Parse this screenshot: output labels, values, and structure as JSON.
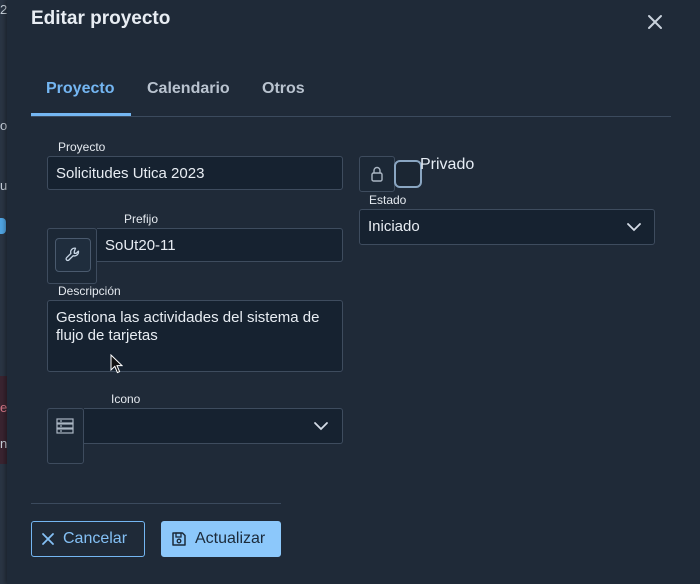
{
  "background": {
    "fragments": [
      {
        "name": "bg-fragment-2",
        "text": "2"
      },
      {
        "name": "bg-fragment-o",
        "text": "o"
      },
      {
        "name": "bg-fragment-u",
        "text": "u"
      },
      {
        "name": "bg-fragment-e",
        "text": "e"
      },
      {
        "name": "bg-fragment-n",
        "text": "n"
      }
    ]
  },
  "dialog": {
    "title": "Editar proyecto"
  },
  "tabs": [
    {
      "label": "Proyecto",
      "active": true
    },
    {
      "label": "Calendario",
      "active": false
    },
    {
      "label": "Otros",
      "active": false
    }
  ],
  "form": {
    "project": {
      "label": "Proyecto",
      "value": "Solicitudes Utica 2023"
    },
    "private": {
      "label": "Privado",
      "checked": false
    },
    "status": {
      "label": "Estado",
      "value": "Iniciado"
    },
    "prefix": {
      "label": "Prefijo",
      "value": "SoUt20-11"
    },
    "description": {
      "label": "Descripción",
      "value": "Gestiona las actividades del sistema de flujo de tarjetas"
    },
    "icon": {
      "label": "Icono",
      "value": ""
    }
  },
  "actions": {
    "cancel_label": "Cancelar",
    "update_label": "Actualizar"
  },
  "colors": {
    "accent": "#74b6f2",
    "primary_button": "#8cc8fb",
    "background": "#1f2a38",
    "input_background": "#162230"
  },
  "icons": [
    "close-icon",
    "lock-icon",
    "wrench-icon",
    "list-icon",
    "chevron-down-icon",
    "x-icon",
    "save-icon"
  ]
}
